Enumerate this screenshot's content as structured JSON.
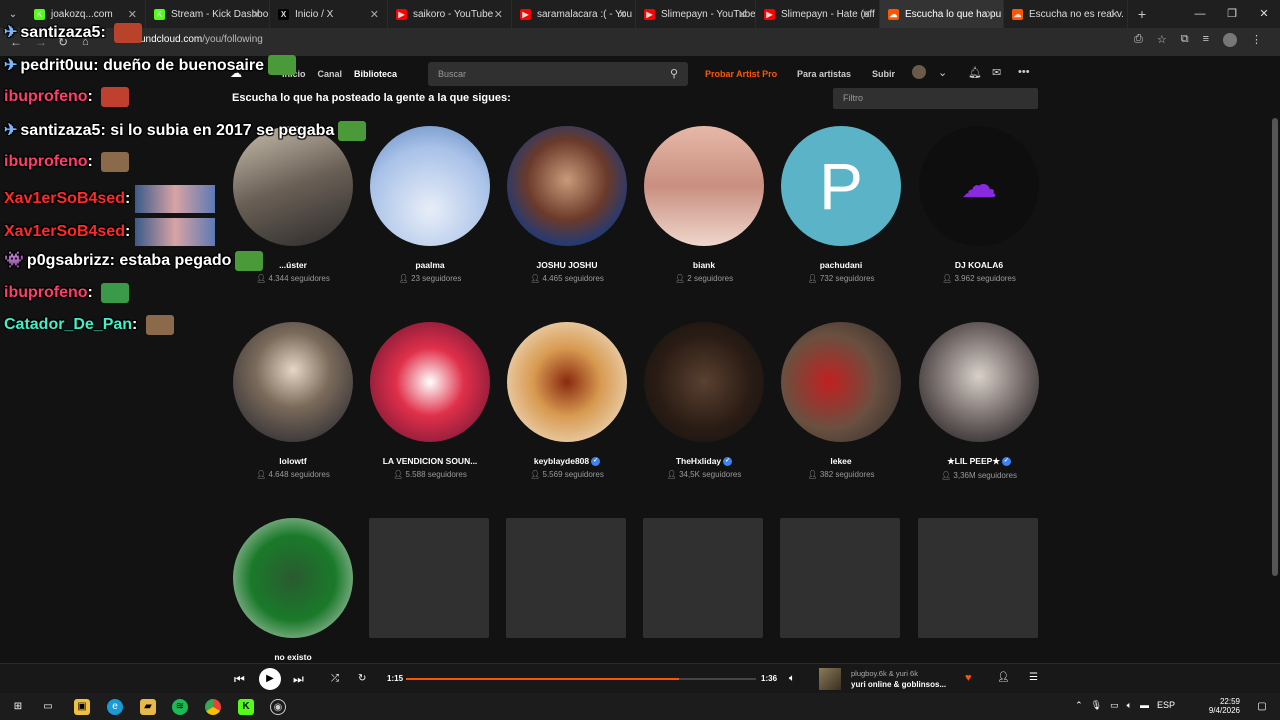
{
  "browser": {
    "tabs": [
      {
        "label": "joakozq...com",
        "fav_color": "#53fc18",
        "fav": "K"
      },
      {
        "label": "Stream - Kick Dashbo",
        "fav_color": "#53fc18",
        "fav": "K"
      },
      {
        "label": "Inicio / X",
        "fav_color": "#000000",
        "fav": "X"
      },
      {
        "label": "saikoro - YouTube",
        "fav_color": "#ff0000",
        "fav": "▶"
      },
      {
        "label": "saramalacara :( - You",
        "fav_color": "#ff0000",
        "fav": "▶"
      },
      {
        "label": "Slimepayn - YouTube",
        "fav_color": "#ff0000",
        "fav": "▶"
      },
      {
        "label": "Slimepayn - Hate (off",
        "fav_color": "#ff0000",
        "fav": "▶"
      },
      {
        "label": "Escucha lo que ha pu",
        "fav_color": "#ff5500",
        "fav": "☁",
        "active": true
      },
      {
        "label": "Escucha no es real v.",
        "fav_color": "#ff5500",
        "fav": "☁"
      }
    ],
    "new_tab": "+",
    "url_domain": "undcloud.com",
    "url_path": "/you/following"
  },
  "soundcloud": {
    "nav": {
      "home": "Inicio",
      "feed": "Canal",
      "library": "Biblioteca",
      "search_placeholder": "Buscar",
      "pro": "Probar Artist Pro",
      "for_artists": "Para artistas",
      "upload": "Subir"
    },
    "heading": "Escucha lo que ha posteado la gente a la que sigues:",
    "filter_placeholder": "Filtro",
    "following": [
      {
        "name": "...úster",
        "followers": "4.344 seguidores",
        "bg": "linear-gradient(160deg,#c9c0b0,#6a5f55 50%,#2a2a2a)",
        "verified": false
      },
      {
        "name": "paalma",
        "followers": "23 seguidores",
        "bg": "radial-gradient(circle at 50% 70%,#e8eef8,#a9c2e8 60%,#5f86c0)",
        "verified": false
      },
      {
        "name": "JOSHU JOSHU",
        "followers": "4.465 seguidores",
        "bg": "radial-gradient(circle at 50% 45%,#c99a7a,#6b3a2a 45%,#1e3a78 75%)",
        "verified": false
      },
      {
        "name": "biank",
        "followers": "2 seguidores",
        "bg": "linear-gradient(180deg,#e6b8a8,#c98f80 50%,#f0d6cc)",
        "verified": false
      },
      {
        "name": "pachudani",
        "followers": "732 seguidores",
        "bg": "#5ab3c7",
        "verified": false,
        "letter": "P"
      },
      {
        "name": "DJ KOALA6",
        "followers": "3.962 seguidores",
        "bg": "#0e0e0e",
        "verified": false
      },
      {
        "name": "lolowtf",
        "followers": "4.648 seguidores",
        "bg": "radial-gradient(circle at 50% 40%,#e6d6c6,#7a6a5a 40%,#1c1e2a)",
        "verified": false
      },
      {
        "name": "LA VENDICION SOUN...",
        "followers": "5.588 seguidores",
        "bg": "radial-gradient(circle at 50% 50%,#ffffff,#e0304a 40%,#5a1030)",
        "verified": false
      },
      {
        "name": "keyblayde808",
        "followers": "5.569 seguidores",
        "bg": "radial-gradient(circle at 50% 50%,#8a2a10,#d89a50 40%,#f4ede0)",
        "verified": true
      },
      {
        "name": "TheHxliday",
        "followers": "34,5K seguidores",
        "bg": "radial-gradient(circle at 50% 50%,#5a4030,#2a1c14 55%,#111)",
        "verified": true
      },
      {
        "name": "lekee",
        "followers": "382 seguidores",
        "bg": "radial-gradient(circle at 40% 50%,#c02020,#6a5040 50%,#2a2a2a)",
        "verified": false
      },
      {
        "name": "★LIL PEEP★",
        "followers": "3,36M seguidores",
        "bg": "radial-gradient(circle at 50% 45%,#d8d0c8,#6a6060 55%,#111)",
        "verified": true
      },
      {
        "name": "no existo",
        "followers": "",
        "bg": "radial-gradient(circle at 50% 50%,#2a5a30,#1a7a2a 50%,#e0e0e0)",
        "verified": false
      }
    ]
  },
  "chat": [
    {
      "user": "santizaza5",
      "msg": "",
      "user_color": "#ffffff",
      "icon": "✈"
    },
    {
      "user": "pedrit0uu",
      "msg": "dueño de buenosaire",
      "user_color": "#ffffff",
      "icon": "✈"
    },
    {
      "user": "ibuprofeno",
      "msg": "",
      "user_color": "#ff3e6c",
      "icon": ""
    },
    {
      "user": "santizaza5",
      "msg": "si lo subia en 2017 se pegaba",
      "user_color": "#ffffff",
      "icon": "✈"
    },
    {
      "user": "ibuprofeno",
      "msg": "",
      "user_color": "#ff3e6c",
      "icon": ""
    },
    {
      "user": "Xav1erSoB4sed",
      "msg": "",
      "user_color": "#ff2a2a",
      "icon": ""
    },
    {
      "user": "Xav1erSoB4sed",
      "msg": "",
      "user_color": "#ff2a2a",
      "icon": ""
    },
    {
      "user": "p0gsabrizz",
      "msg": "estaba pegado",
      "user_color": "#ffffff",
      "icon": "👾"
    },
    {
      "user": "ibuprofeno",
      "msg": "",
      "user_color": "#ff3e6c",
      "icon": ""
    },
    {
      "user": "Catador_De_Pan",
      "msg": "",
      "user_color": "#41f0c8",
      "icon": ""
    }
  ],
  "player": {
    "elapsed": "1:15",
    "duration": "1:36",
    "progress_fraction": 0.78,
    "artist": "plugboy.6k & yuri 6k",
    "track": "yuri online & goblinsos..."
  },
  "taskbar": {
    "lang": "ESP",
    "time": "22:59",
    "date": "9/4/2026"
  }
}
